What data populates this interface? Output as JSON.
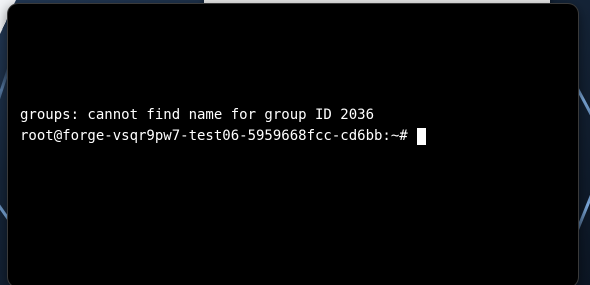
{
  "terminal": {
    "lines": [
      "groups: cannot find name for group ID 2036"
    ],
    "prompt": "root@forge-vsqr9pw7-test06-5959668fcc-cd6bb:~#"
  },
  "colors": {
    "background": "#000000",
    "text": "#ffffff",
    "cursor": "#ffffff"
  }
}
